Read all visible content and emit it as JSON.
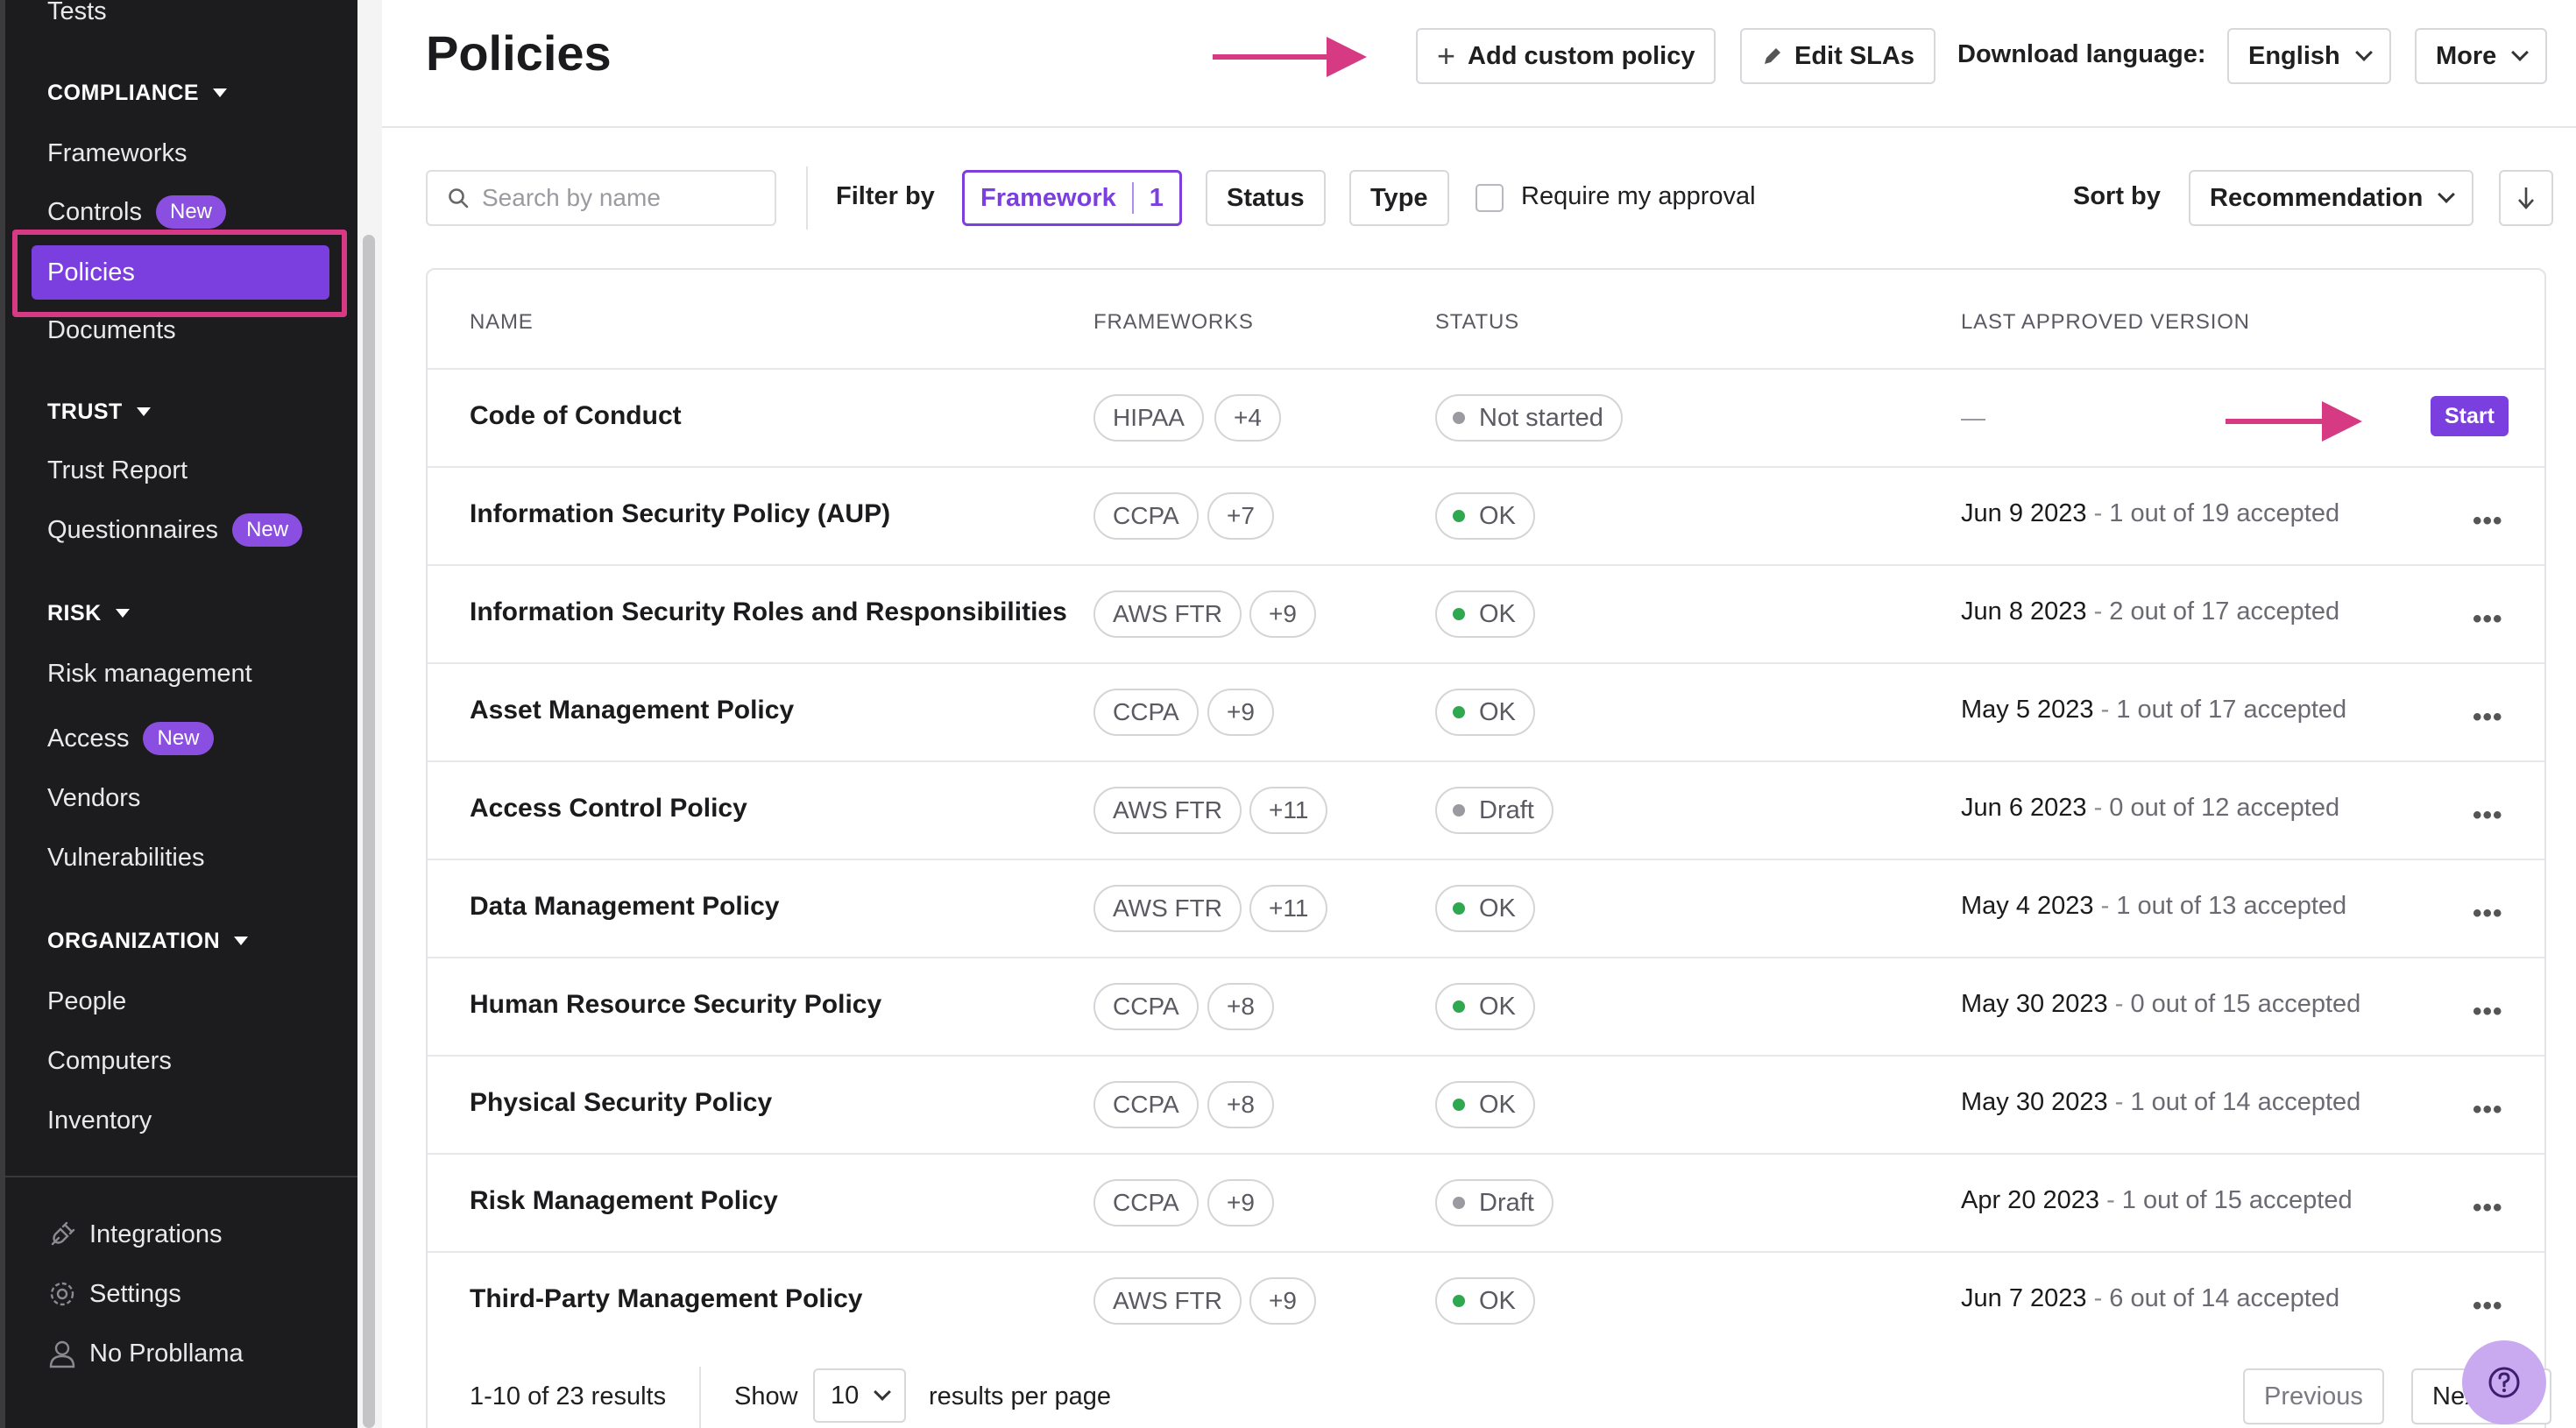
{
  "sidebar": {
    "top_item": "Tests",
    "sections": {
      "compliance": "COMPLIANCE",
      "trust": "TRUST",
      "risk": "RISK",
      "organization": "ORGANIZATION"
    },
    "items": {
      "frameworks": "Frameworks",
      "controls": "Controls",
      "policies": "Policies",
      "documents": "Documents",
      "trust_report": "Trust Report",
      "questionnaires": "Questionnaires",
      "risk_management": "Risk management",
      "access": "Access",
      "vendors": "Vendors",
      "vulnerabilities": "Vulnerabilities",
      "people": "People",
      "computers": "Computers",
      "inventory": "Inventory",
      "integrations": "Integrations",
      "settings": "Settings",
      "user": "No Probllama"
    },
    "new_badge": "New",
    "accent_color": "#7b3fe0",
    "highlight_color": "#d63a82"
  },
  "header": {
    "title": "Policies",
    "add_custom_policy": "Add custom policy",
    "edit_slas": "Edit SLAs",
    "download_language_label": "Download language:",
    "language": "English",
    "more": "More"
  },
  "filters": {
    "search_placeholder": "Search by name",
    "filter_by": "Filter by",
    "framework": "Framework",
    "framework_count": "1",
    "status": "Status",
    "type": "Type",
    "require_approval": "Require my approval",
    "sort_by": "Sort by",
    "sort_value": "Recommendation"
  },
  "table": {
    "columns": [
      "NAME",
      "FRAMEWORKS",
      "STATUS",
      "LAST APPROVED VERSION"
    ],
    "rows": [
      {
        "name": "Code of Conduct",
        "fw": "HIPAA",
        "more": "+4",
        "status": "Not started",
        "status_color": "#9a9aa0",
        "date": "",
        "accepted": "",
        "action": "Start"
      },
      {
        "name": "Information Security Policy (AUP)",
        "fw": "CCPA",
        "more": "+7",
        "status": "OK",
        "status_color": "#2fa84f",
        "date": "Jun 9 2023",
        "accepted": "1 out of 19 accepted"
      },
      {
        "name": "Information Security Roles and Responsibilities",
        "fw": "AWS FTR",
        "more": "+9",
        "status": "OK",
        "status_color": "#2fa84f",
        "date": "Jun 8 2023",
        "accepted": "2 out of 17 accepted"
      },
      {
        "name": "Asset Management Policy",
        "fw": "CCPA",
        "more": "+9",
        "status": "OK",
        "status_color": "#2fa84f",
        "date": "May 5 2023",
        "accepted": "1 out of 17 accepted"
      },
      {
        "name": "Access Control Policy",
        "fw": "AWS FTR",
        "more": "+11",
        "status": "Draft",
        "status_color": "#9a9aa0",
        "date": "Jun 6 2023",
        "accepted": "0 out of 12 accepted"
      },
      {
        "name": "Data Management Policy",
        "fw": "AWS FTR",
        "more": "+11",
        "status": "OK",
        "status_color": "#2fa84f",
        "date": "May 4 2023",
        "accepted": "1 out of 13 accepted"
      },
      {
        "name": "Human Resource Security Policy",
        "fw": "CCPA",
        "more": "+8",
        "status": "OK",
        "status_color": "#2fa84f",
        "date": "May 30 2023",
        "accepted": "0 out of 15 accepted"
      },
      {
        "name": "Physical Security Policy",
        "fw": "CCPA",
        "more": "+8",
        "status": "OK",
        "status_color": "#2fa84f",
        "date": "May 30 2023",
        "accepted": "1 out of 14 accepted"
      },
      {
        "name": "Risk Management Policy",
        "fw": "CCPA",
        "more": "+9",
        "status": "Draft",
        "status_color": "#9a9aa0",
        "date": "Apr 20 2023",
        "accepted": "1 out of 15 accepted"
      },
      {
        "name": "Third-Party Management Policy",
        "fw": "AWS FTR",
        "more": "+9",
        "status": "OK",
        "status_color": "#2fa84f",
        "date": "Jun 7 2023",
        "accepted": "6 out of 14 accepted"
      }
    ]
  },
  "footer": {
    "results": "1-10 of 23 results",
    "show": "Show",
    "per_page_value": "10",
    "per_page_label": "results per page",
    "previous": "Previous",
    "next": "Next"
  }
}
